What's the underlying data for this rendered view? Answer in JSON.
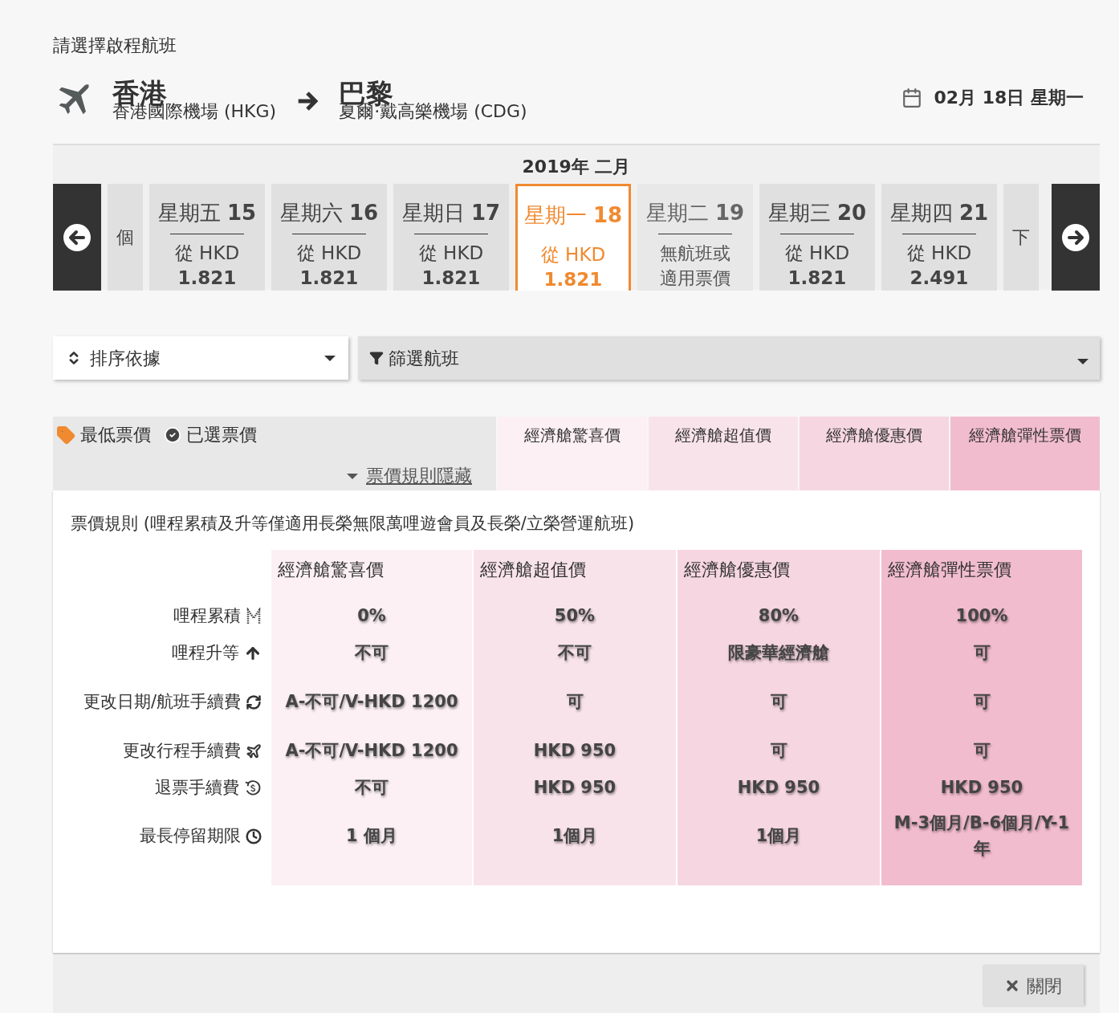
{
  "heading": "請選擇啟程航班",
  "route": {
    "origin_city": "香港",
    "origin_airport": "香港國際機場 (HKG)",
    "dest_city": "巴黎",
    "dest_airport": "夏爾·戴高樂機場 (CDG)",
    "date": "02月 18日 星期一"
  },
  "month": "2019年 二月",
  "dates": [
    {
      "kind": "partial",
      "lines": [
        "個"
      ]
    },
    {
      "kind": "fare",
      "day": "星期五",
      "date": "15",
      "from": "從 HKD",
      "price": "1.821",
      "selected": false
    },
    {
      "kind": "fare",
      "day": "星期六",
      "date": "16",
      "from": "從 HKD",
      "price": "1.821",
      "selected": false
    },
    {
      "kind": "fare",
      "day": "星期日",
      "date": "17",
      "from": "從 HKD",
      "price": "1.821",
      "selected": false
    },
    {
      "kind": "fare",
      "day": "星期一",
      "date": "18",
      "from": "從 HKD",
      "price": "1.821",
      "selected": true
    },
    {
      "kind": "none",
      "day": "星期二",
      "date": "19",
      "note": "無航班或適用票價",
      "selected": false
    },
    {
      "kind": "fare",
      "day": "星期三",
      "date": "20",
      "from": "從 HKD",
      "price": "1.821",
      "selected": false
    },
    {
      "kind": "fare",
      "day": "星期四",
      "date": "21",
      "from": "從 HKD",
      "price": "2.491",
      "selected": false
    },
    {
      "kind": "partial",
      "lines": [
        "下"
      ]
    }
  ],
  "sort": {
    "label": "排序依據"
  },
  "filter": {
    "label": "篩選航班"
  },
  "legend": {
    "lowest": "最低票價",
    "selected": "已選票價",
    "toggle": "票價規則隱藏"
  },
  "fare_columns": [
    {
      "label": "經濟艙驚喜價",
      "color": "#fcf0f4"
    },
    {
      "label": "經濟艙超值價",
      "color": "#f9e3ea"
    },
    {
      "label": "經濟艙優惠價",
      "color": "#f6d6e1"
    },
    {
      "label": "經濟艙彈性票價",
      "color": "#f2bccf"
    }
  ],
  "rules": {
    "title": "票價規則 (哩程累積及升等僅適用長榮無限萬哩遊會員及長榮/立榮營運航班)",
    "columns": [
      "經濟艙驚喜價",
      "經濟艙超值價",
      "經濟艙優惠價",
      "經濟艙彈性票價"
    ],
    "rows": [
      {
        "label": "哩程累積",
        "values": [
          "0%",
          "50%",
          "80%",
          "100%"
        ]
      },
      {
        "label": "哩程升等",
        "values": [
          "不可",
          "不可",
          "限豪華經濟艙",
          "可"
        ]
      },
      {
        "label": "更改日期/航班手續費",
        "values": [
          "A-不可/V-HKD 1200",
          "可",
          "可",
          "可"
        ]
      },
      {
        "label": "更改行程手續費",
        "values": [
          "A-不可/V-HKD 1200",
          "HKD 950",
          "可",
          "可"
        ]
      },
      {
        "label": "退票手續費",
        "values": [
          "不可",
          "HKD 950",
          "HKD 950",
          "HKD 950"
        ]
      },
      {
        "label": "最長停留期限",
        "values": [
          "1 個月",
          "1個月",
          "1個月",
          "M-3個月/B-6個月/Y-1年"
        ]
      }
    ]
  },
  "close": "關閉"
}
